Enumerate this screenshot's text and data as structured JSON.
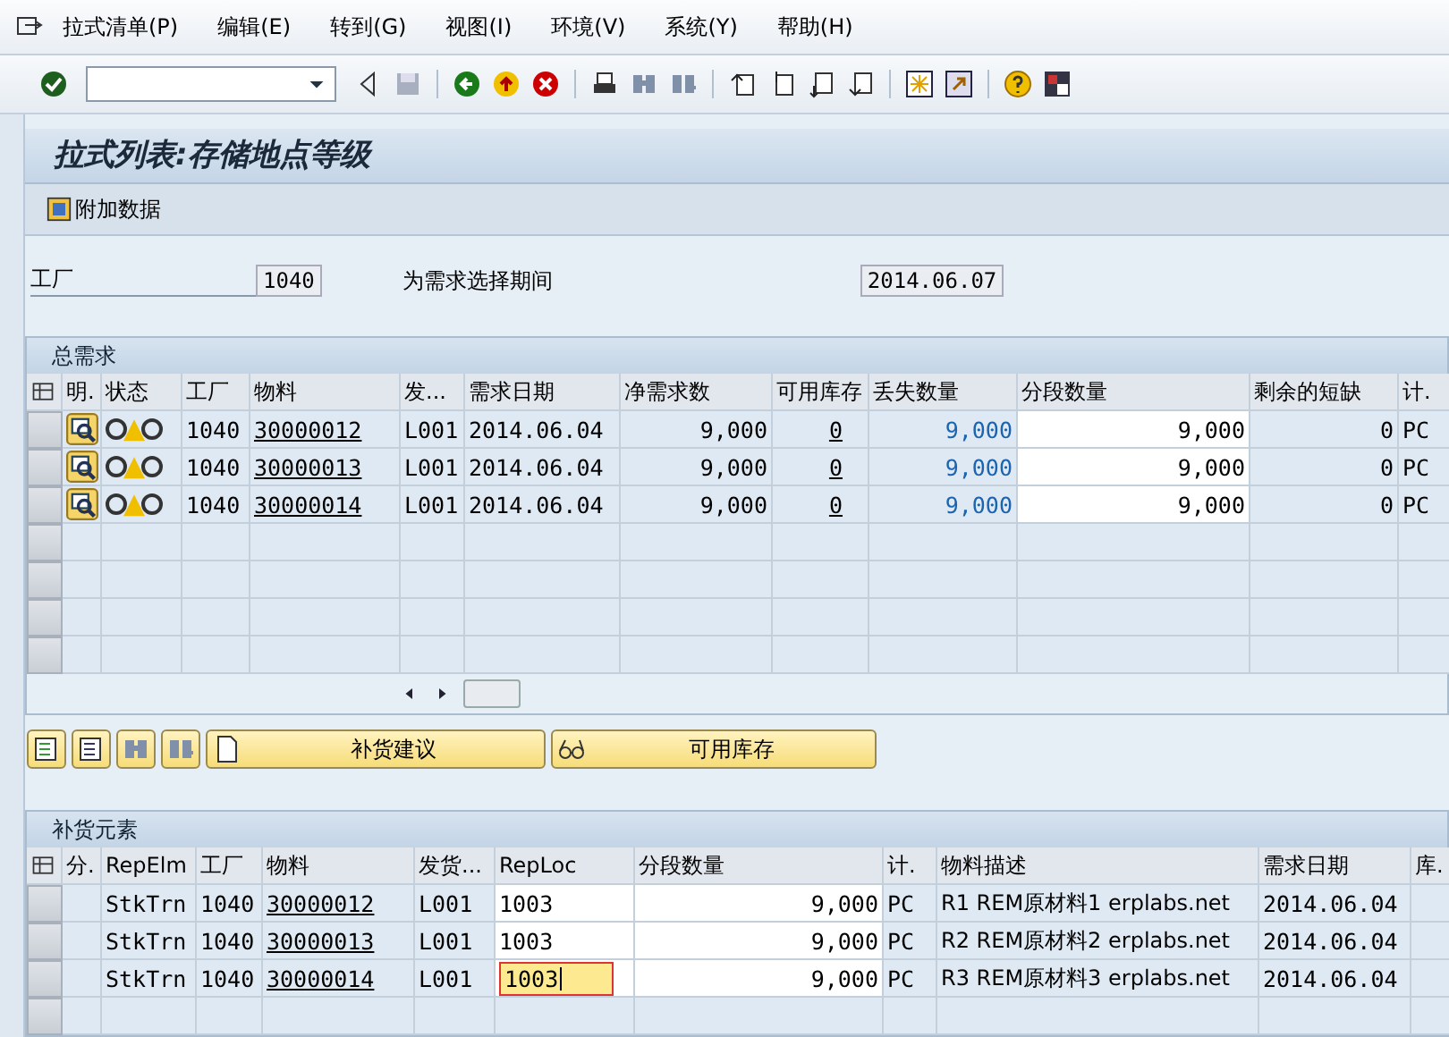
{
  "menu": [
    {
      "label": "拉式清单(P)"
    },
    {
      "label": "编辑(E)"
    },
    {
      "label": "转到(G)"
    },
    {
      "label": "视图(I)"
    },
    {
      "label": "环境(V)"
    },
    {
      "label": "系统(Y)"
    },
    {
      "label": "帮助(H)"
    }
  ],
  "title": "拉式列表:存储地点等级",
  "app_toolbar": [
    {
      "label": "附加数据"
    }
  ],
  "header_fields": [
    {
      "label": "工厂",
      "value": "1040"
    },
    {
      "label": "为需求选择期间",
      "value": "2014.06.07"
    }
  ],
  "demand_table": {
    "title": "总需求",
    "columns": [
      {
        "label": "明.",
        "kind": "detail"
      },
      {
        "label": "状态",
        "kind": "status"
      },
      {
        "label": "工厂",
        "kind": "text"
      },
      {
        "label": "物料",
        "kind": "link"
      },
      {
        "label": "发...",
        "kind": "text"
      },
      {
        "label": "需求日期",
        "kind": "text"
      },
      {
        "label": "净需求数",
        "kind": "num"
      },
      {
        "label": "可用库存",
        "kind": "numlink"
      },
      {
        "label": "丢失数量",
        "kind": "blue"
      },
      {
        "label": "分段数量",
        "kind": "input"
      },
      {
        "label": "剩余的短缺",
        "kind": "num"
      },
      {
        "label": "计.",
        "kind": "text"
      }
    ],
    "rows": [
      {
        "color": "#f0c000",
        "cells": [
          "",
          "",
          "1040",
          "30000012",
          "L001",
          "2014.06.04",
          "9,000",
          "0",
          "9,000",
          "9,000",
          "0",
          "PC"
        ]
      },
      {
        "color": "#f0c000",
        "cells": [
          "",
          "",
          "1040",
          "30000013",
          "L001",
          "2014.06.04",
          "9,000",
          "0",
          "9,000",
          "9,000",
          "0",
          "PC"
        ]
      },
      {
        "color": "#f0c000",
        "cells": [
          "",
          "",
          "1040",
          "30000014",
          "L001",
          "2014.06.04",
          "9,000",
          "0",
          "9,000",
          "9,000",
          "0",
          "PC"
        ]
      }
    ]
  },
  "buttons": [
    {
      "kind": "icon"
    },
    {
      "kind": "icon"
    },
    {
      "kind": "icon"
    },
    {
      "kind": "icon"
    },
    {
      "kind": "text",
      "label": "补货建议"
    },
    {
      "kind": "text",
      "label": "可用库存"
    }
  ],
  "supply_table": {
    "title": "补货元素",
    "columns": [
      {
        "label": "分.",
        "kind": "blank"
      },
      {
        "label": "RepElm",
        "kind": "text"
      },
      {
        "label": "工厂",
        "kind": "text"
      },
      {
        "label": "物料",
        "kind": "link"
      },
      {
        "label": "发货...",
        "kind": "text"
      },
      {
        "label": "RepLoc",
        "kind": "edit"
      },
      {
        "label": "分段数量",
        "kind": "input"
      },
      {
        "label": "计.",
        "kind": "text"
      },
      {
        "label": "物料描述",
        "kind": "text"
      },
      {
        "label": "需求日期",
        "kind": "text"
      },
      {
        "label": "库.",
        "kind": "blank"
      }
    ],
    "rows": [
      {
        "focused": false,
        "cells": [
          "",
          "StkTrn",
          "1040",
          "30000012",
          "L001",
          "1003",
          "9,000",
          "PC",
          "R1 REM原材料1 erplabs.net",
          "2014.06.04",
          ""
        ]
      },
      {
        "focused": false,
        "cells": [
          "",
          "StkTrn",
          "1040",
          "30000013",
          "L001",
          "1003",
          "9,000",
          "PC",
          "R2 REM原材料2 erplabs.net",
          "2014.06.04",
          ""
        ]
      },
      {
        "focused": true,
        "cells": [
          "",
          "StkTrn",
          "1040",
          "30000014",
          "L001",
          "1003",
          "9,000",
          "PC",
          "R3 REM原材料3 erplabs.net",
          "2014.06.04",
          ""
        ]
      }
    ]
  }
}
